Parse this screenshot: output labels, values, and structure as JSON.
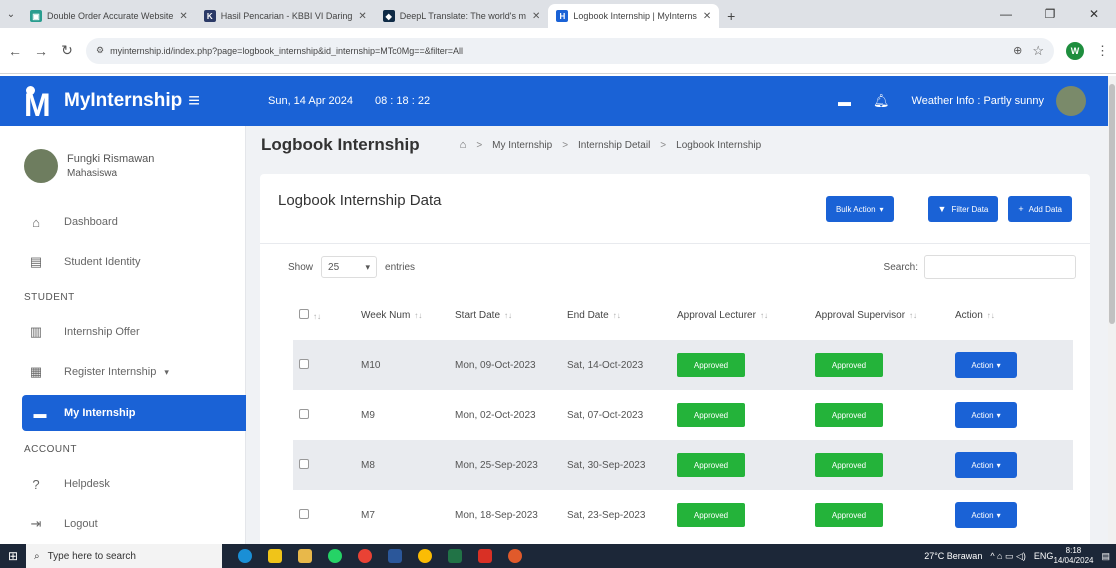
{
  "browser": {
    "tabs": [
      {
        "label": "Double Order Accurate Website",
        "favicon_color": "#2a9d8f",
        "active": false
      },
      {
        "label": "Hasil Pencarian - KBBI VI Daring",
        "favicon_color": "#2b3a67",
        "active": false
      },
      {
        "label": "DeepL Translate: The world's m",
        "favicon_color": "#0f2b46",
        "active": false
      },
      {
        "label": "Logbook Internship | MyInterns",
        "favicon_color": "#1a62d6",
        "active": true
      }
    ],
    "url": "myinternship.id/index.php?page=logbook_internship&id_internship=MTc0Mg==&filter=All",
    "profile_initial": "W"
  },
  "header": {
    "brand": "MyInternship",
    "date": "Sun, 14 Apr 2024",
    "time": "08 : 18 : 22",
    "weather": "Weather Info : Partly sunny"
  },
  "sidebar": {
    "user_name": "Fungki Rismawan",
    "user_role": "Mahasiswa",
    "dashboard": "Dashboard",
    "student_identity": "Student Identity",
    "student_heading": "STUDENT",
    "internship_offer": "Internship Offer",
    "register_internship": "Register Internship",
    "my_internship": "My Internship",
    "account_heading": "ACCOUNT",
    "helpdesk": "Helpdesk",
    "logout": "Logout"
  },
  "page": {
    "title": "Logbook Internship",
    "breadcrumb": [
      "My Internship",
      "Internship Detail",
      "Logbook Internship"
    ]
  },
  "card": {
    "title": "Logbook Internship Data",
    "bulk_action": "Bulk Action",
    "filter_data": "Filter Data",
    "add_data": "Add Data"
  },
  "datatable": {
    "show_label": "Show",
    "entries_value": "25",
    "entries_label": "entries",
    "search_label": "Search:",
    "search_value": "",
    "columns": {
      "week": "Week Num",
      "start": "Start Date",
      "end": "End Date",
      "lecturer": "Approval Lecturer",
      "supervisor": "Approval Supervisor",
      "action": "Action"
    },
    "action_label": "Action",
    "rows": [
      {
        "week": "M10",
        "start": "Mon, 09-Oct-2023",
        "end": "Sat, 14-Oct-2023",
        "lecturer": "Approved",
        "supervisor": "Approved"
      },
      {
        "week": "M9",
        "start": "Mon, 02-Oct-2023",
        "end": "Sat, 07-Oct-2023",
        "lecturer": "Approved",
        "supervisor": "Approved"
      },
      {
        "week": "M8",
        "start": "Mon, 25-Sep-2023",
        "end": "Sat, 30-Sep-2023",
        "lecturer": "Approved",
        "supervisor": "Approved"
      },
      {
        "week": "M7",
        "start": "Mon, 18-Sep-2023",
        "end": "Sat, 23-Sep-2023",
        "lecturer": "Approved",
        "supervisor": "Approved"
      }
    ]
  },
  "taskbar": {
    "search_placeholder": "Type here to search",
    "weather": "27°C  Berawan",
    "lang": "ENG",
    "time": "8:18",
    "date": "14/04/2024"
  },
  "colors": {
    "primary": "#1a62d6",
    "approved": "#24b33a",
    "row_shade": "#e9ebef"
  }
}
